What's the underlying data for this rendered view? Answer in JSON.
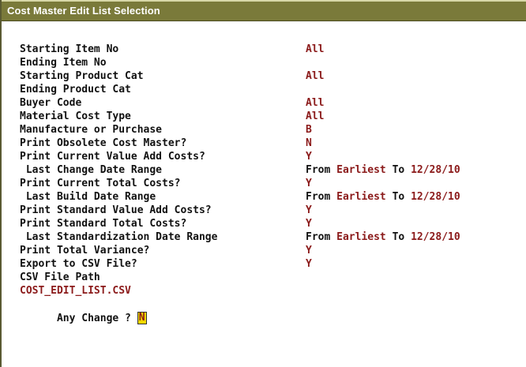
{
  "window": {
    "title": "Cost Master Edit List Selection"
  },
  "fields": [
    {
      "label": "Starting Item No",
      "value": "All"
    },
    {
      "label": "Ending Item No",
      "value": ""
    },
    {
      "label": "Starting Product Cat",
      "value": "All"
    },
    {
      "label": "Ending Product Cat",
      "value": ""
    },
    {
      "label": "Buyer Code",
      "value": "All"
    },
    {
      "label": "Material Cost Type",
      "value": "All"
    },
    {
      "label": "Manufacture or Purchase",
      "value": "B"
    },
    {
      "label": "Print Obsolete Cost Master?",
      "value": "N"
    },
    {
      "label": "Print Current Value Add Costs?",
      "value": "Y"
    },
    {
      "label": " Last Change Date Range",
      "from_label": "From",
      "from_value": "Earliest",
      "to_label": "To",
      "to_value": "12/28/10"
    },
    {
      "label": "Print Current Total Costs?",
      "value": "Y"
    },
    {
      "label": " Last Build Date Range",
      "from_label": "From",
      "from_value": "Earliest",
      "to_label": "To",
      "to_value": "12/28/10"
    },
    {
      "label": "Print Standard Value Add Costs?",
      "value": "Y"
    },
    {
      "label": "Print Standard Total Costs?",
      "value": "Y"
    },
    {
      "label": " Last Standardization Date Range",
      "from_label": "From",
      "from_value": "Earliest",
      "to_label": "To",
      "to_value": "12/28/10"
    },
    {
      "label": "Print Total Variance?",
      "value": "Y"
    },
    {
      "label": "Export to CSV File?",
      "value": "Y"
    },
    {
      "label": "CSV File Path",
      "value": ""
    }
  ],
  "csv_path_value": "COST_EDIT_LIST.CSV",
  "prompt": {
    "label": "Any Change ? ",
    "value": "N"
  },
  "colors": {
    "titlebar": "#7a7a3a",
    "value_text": "#8b1a1a",
    "label_text": "#111111",
    "cursor_bg": "#f2d900"
  }
}
